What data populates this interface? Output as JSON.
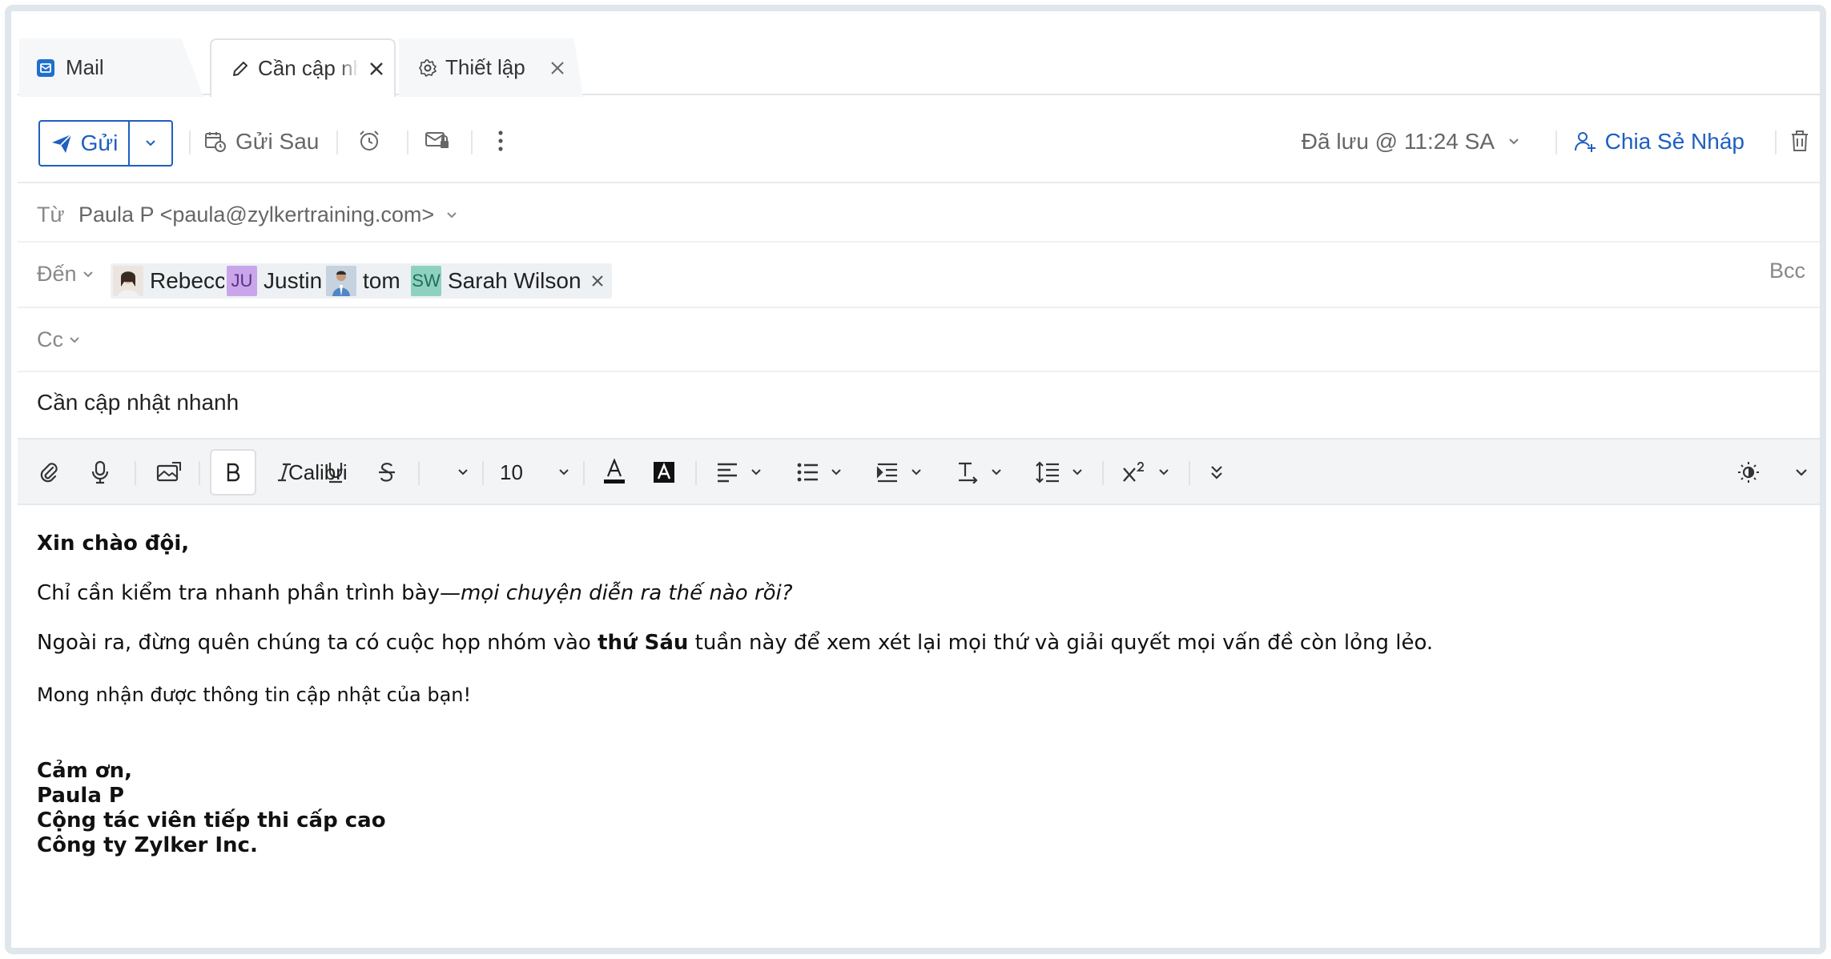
{
  "tabs": {
    "mail": {
      "label": "Mail"
    },
    "draft": {
      "label": "Cần cập nhật nhanh"
    },
    "settings": {
      "label": "Thiết lập"
    }
  },
  "toolbar": {
    "send_label": "Gửi",
    "send_later_label": "Gửi Sau",
    "saved_status": "Đã lưu @ 11:24 SA",
    "share_draft_label": "Chia Sẻ Nháp"
  },
  "from": {
    "label": "Từ",
    "value": "Paula P <paula@zylkertraining.com>"
  },
  "to": {
    "label": "Đến",
    "recipients": [
      {
        "name": "Rebecca",
        "initials": "",
        "color": "#d9cfc9"
      },
      {
        "name": "Justin",
        "initials": "JU",
        "color": "#c8a8e8"
      },
      {
        "name": "tom",
        "initials": "",
        "color": "#b9c8d6"
      },
      {
        "name": "Sarah Wilson",
        "initials": "SW",
        "color": "#8fd0c0"
      }
    ],
    "bcc_label": "Bcc"
  },
  "cc": {
    "label": "Cc"
  },
  "subject": "Cần cập nhật nhanh",
  "format": {
    "font": "Calibri",
    "size": "10"
  },
  "message": {
    "greeting": "Xin chào đội,",
    "line1_plain": "Chỉ cần kiểm tra nhanh phần trình bày—",
    "line1_italic": "mọi chuyện diễn ra thế nào rồi?",
    "line2_a": "Ngoài ra, đừng quên chúng ta có cuộc họp nhóm vào ",
    "line2_bold": "thứ Sáu",
    "line2_b": " tuần này để xem xét lại mọi thứ và giải quyết mọi vấn đề còn lỏng lẻo.",
    "line3": "Mong nhận được thông tin cập nhật của bạn!",
    "sign_thanks": "Cảm ơn,",
    "sign_name": "Paula P",
    "sign_title": "Cộng tác viên tiếp thi cấp cao",
    "sign_company": "Công ty Zylker Inc."
  },
  "colors": {
    "accent": "#1f5fbf",
    "frame": "#dfe6ec"
  }
}
